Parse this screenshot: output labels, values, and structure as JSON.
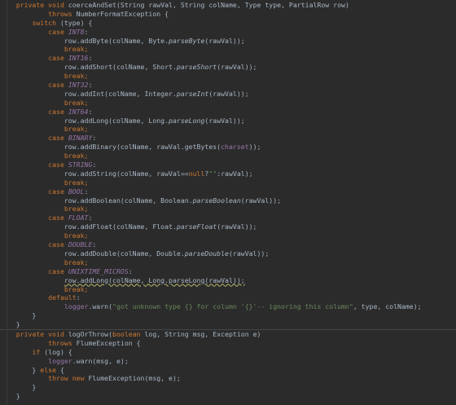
{
  "editor": {
    "lines": [
      [
        {
          "t": "    "
        },
        {
          "t": "private void ",
          "c": "kw"
        },
        {
          "t": "coerceAndSet",
          "c": "tok-call"
        },
        {
          "t": "(String rawVal, String colName, Type type, PartialRow row)"
        }
      ],
      [
        {
          "t": "            "
        },
        {
          "t": "throws ",
          "c": "kw"
        },
        {
          "t": "NumberFormatException {"
        }
      ],
      [
        {
          "t": "        "
        },
        {
          "t": "switch ",
          "c": "kw"
        },
        {
          "t": "(type) {"
        }
      ],
      [
        {
          "t": "            "
        },
        {
          "t": "case ",
          "c": "kw"
        },
        {
          "t": "INT8",
          "c": "tok-enum"
        },
        {
          "t": ":"
        }
      ],
      [
        {
          "t": "                row.addByte(colName, Byte."
        },
        {
          "t": "parseByte",
          "c": "tok-method-static"
        },
        {
          "t": "(rawVal));"
        }
      ],
      [
        {
          "t": "                "
        },
        {
          "t": "break;",
          "c": "kw"
        }
      ],
      [
        {
          "t": "            "
        },
        {
          "t": "case ",
          "c": "kw"
        },
        {
          "t": "INT16",
          "c": "tok-enum"
        },
        {
          "t": ":"
        }
      ],
      [
        {
          "t": "                row.addShort(colName, Short."
        },
        {
          "t": "parseShort",
          "c": "tok-method-static"
        },
        {
          "t": "(rawVal));"
        }
      ],
      [
        {
          "t": "                "
        },
        {
          "t": "break;",
          "c": "kw"
        }
      ],
      [
        {
          "t": "            "
        },
        {
          "t": "case ",
          "c": "kw"
        },
        {
          "t": "INT32",
          "c": "tok-enum"
        },
        {
          "t": ":"
        }
      ],
      [
        {
          "t": "                row.addInt(colName, Integer."
        },
        {
          "t": "parseInt",
          "c": "tok-method-static"
        },
        {
          "t": "(rawVal));"
        }
      ],
      [
        {
          "t": "                "
        },
        {
          "t": "break;",
          "c": "kw"
        }
      ],
      [
        {
          "t": "            "
        },
        {
          "t": "case ",
          "c": "kw"
        },
        {
          "t": "INT64",
          "c": "tok-enum"
        },
        {
          "t": ":"
        }
      ],
      [
        {
          "t": "                row.addLong(colName, Long."
        },
        {
          "t": "parseLong",
          "c": "tok-method-static"
        },
        {
          "t": "(rawVal));"
        }
      ],
      [
        {
          "t": "                "
        },
        {
          "t": "break;",
          "c": "kw"
        }
      ],
      [
        {
          "t": "            "
        },
        {
          "t": "case ",
          "c": "kw"
        },
        {
          "t": "BINARY",
          "c": "tok-enum"
        },
        {
          "t": ":"
        }
      ],
      [
        {
          "t": "                row.addBinary(colName, rawVal.getBytes("
        },
        {
          "t": "charset",
          "c": "tok-field"
        },
        {
          "t": "));"
        }
      ],
      [
        {
          "t": "                "
        },
        {
          "t": "break;",
          "c": "kw"
        }
      ],
      [
        {
          "t": "            "
        },
        {
          "t": "case ",
          "c": "kw"
        },
        {
          "t": "STRING",
          "c": "tok-enum"
        },
        {
          "t": ":"
        }
      ],
      [
        {
          "t": "                row.addString(colName, rawVal=="
        },
        {
          "t": "null",
          "c": "kw"
        },
        {
          "t": "?"
        },
        {
          "t": "\"\"",
          "c": "tok-str"
        },
        {
          "t": ":rawVal);"
        }
      ],
      [
        {
          "t": "                "
        },
        {
          "t": "break;",
          "c": "kw"
        }
      ],
      [
        {
          "t": "            "
        },
        {
          "t": "case ",
          "c": "kw"
        },
        {
          "t": "BOOL",
          "c": "tok-enum"
        },
        {
          "t": ":"
        }
      ],
      [
        {
          "t": "                row.addBoolean(colName, Boolean."
        },
        {
          "t": "parseBoolean",
          "c": "tok-method-static"
        },
        {
          "t": "(rawVal));"
        }
      ],
      [
        {
          "t": "                "
        },
        {
          "t": "break;",
          "c": "kw"
        }
      ],
      [
        {
          "t": "            "
        },
        {
          "t": "case ",
          "c": "kw"
        },
        {
          "t": "FLOAT",
          "c": "tok-enum"
        },
        {
          "t": ":"
        }
      ],
      [
        {
          "t": "                row.addFloat(colName, Float."
        },
        {
          "t": "parseFloat",
          "c": "tok-method-static"
        },
        {
          "t": "(rawVal));"
        }
      ],
      [
        {
          "t": "                "
        },
        {
          "t": "break;",
          "c": "kw"
        }
      ],
      [
        {
          "t": "            "
        },
        {
          "t": "case ",
          "c": "kw"
        },
        {
          "t": "DOUBLE",
          "c": "tok-enum"
        },
        {
          "t": ":"
        }
      ],
      [
        {
          "t": "                row.addDouble(colName, Double."
        },
        {
          "t": "parseDouble",
          "c": "tok-method-static"
        },
        {
          "t": "(rawVal));"
        }
      ],
      [
        {
          "t": "                "
        },
        {
          "t": "break;",
          "c": "kw"
        }
      ],
      [
        {
          "t": "            "
        },
        {
          "t": "case ",
          "c": "kw"
        },
        {
          "t": "UNIXTIME_MICROS",
          "c": "tok-enum"
        },
        {
          "t": ":"
        }
      ],
      [
        {
          "t": "                "
        },
        {
          "t": "row.addLong(colName, Long.parseLong(rawVal));",
          "c": "tok-warn-ul"
        }
      ],
      [
        {
          "t": "                "
        },
        {
          "t": "break;",
          "c": "kw"
        }
      ],
      [
        {
          "t": "            "
        },
        {
          "t": "default",
          "c": "kw"
        },
        {
          "t": ":"
        }
      ],
      [
        {
          "t": "                "
        },
        {
          "t": "logger",
          "c": "tok-logger"
        },
        {
          "t": ".warn("
        },
        {
          "t": "\"got unknown type {} for column '{}'-- ignoring this column\"",
          "c": "tok-str"
        },
        {
          "t": ", type, colName);"
        }
      ],
      [
        {
          "t": "        }"
        }
      ],
      [
        {
          "t": "    }"
        }
      ],
      [
        {
          "t": "    "
        },
        {
          "t": "private void ",
          "c": "kw"
        },
        {
          "t": "logOrThrow",
          "c": "tok-call"
        },
        {
          "t": "("
        },
        {
          "t": "boolean ",
          "c": "kw"
        },
        {
          "t": "log, String msg, Exception e)"
        }
      ],
      [
        {
          "t": "            "
        },
        {
          "t": "throws ",
          "c": "kw"
        },
        {
          "t": "FlumeException {"
        }
      ],
      [
        {
          "t": "        "
        },
        {
          "t": "if ",
          "c": "kw"
        },
        {
          "t": "(log) {"
        }
      ],
      [
        {
          "t": "            "
        },
        {
          "t": "logger",
          "c": "tok-logger"
        },
        {
          "t": ".warn(msg, e);"
        }
      ],
      [
        {
          "t": "        } "
        },
        {
          "t": "else ",
          "c": "kw"
        },
        {
          "t": "{"
        }
      ],
      [
        {
          "t": "            "
        },
        {
          "t": "throw new ",
          "c": "kw"
        },
        {
          "t": "FlumeException(msg, e);"
        }
      ],
      [
        {
          "t": "        }"
        }
      ],
      [
        {
          "t": "    }"
        }
      ]
    ],
    "colors": {
      "background": "#2b2b2b",
      "text": "#a9b7c6",
      "keyword": "#cc7832",
      "enum": "#9876aa",
      "string": "#6a8759",
      "separator": "#454545"
    }
  }
}
